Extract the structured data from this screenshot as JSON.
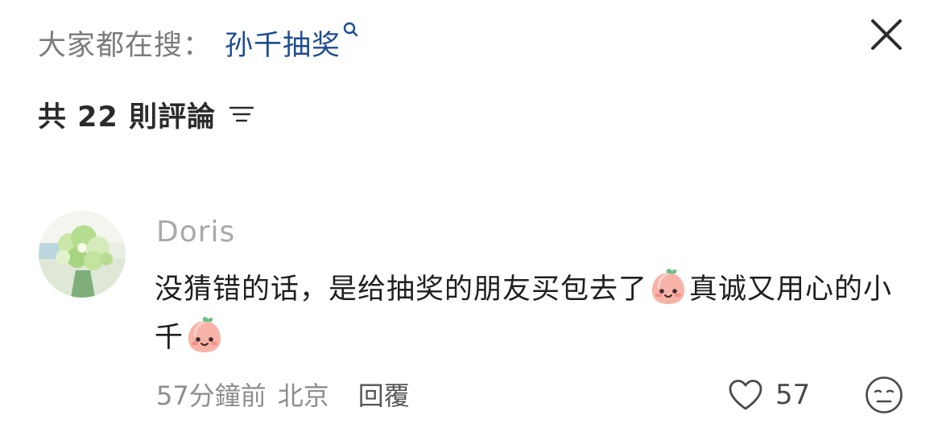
{
  "header": {
    "search_prefix": "大家都在搜：",
    "search_term": "孙千抽奖",
    "search_icon": "magnifier-icon",
    "close_icon": "close-icon"
  },
  "comments_header": {
    "count_text": "共 22 則評論",
    "sort_icon": "filter-lines-icon"
  },
  "comment": {
    "username": "Doris",
    "avatar": "avatar-green-flowers",
    "text_part1": "没猜错的话，是给抽奖的朋友买包去了",
    "text_part2": "真诚又用心的小千",
    "emoji": "peach-smile-emoji",
    "time": "57分鐘前",
    "location": "北京",
    "reply_label": "回覆",
    "like_count": "57",
    "like_icon": "heart-outline-icon",
    "reaction_icon": "neutral-face-icon"
  },
  "colors": {
    "search_term": "#1e4d8f",
    "muted_text": "#8e8e8e",
    "username": "#a9a9a9",
    "body_text": "#1f1f1f"
  }
}
